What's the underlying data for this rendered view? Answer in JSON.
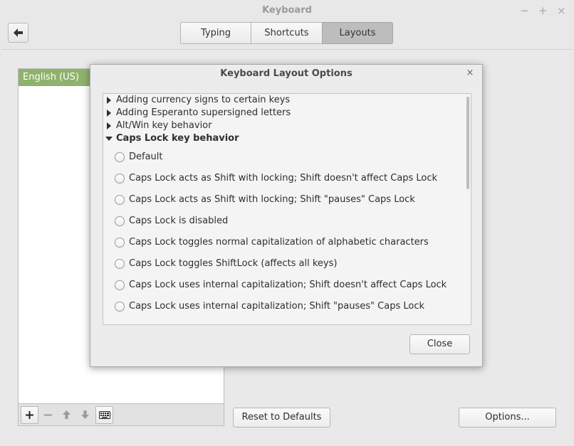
{
  "window": {
    "title": "Keyboard",
    "controls": [
      "−",
      "+",
      "×"
    ]
  },
  "tabs": [
    {
      "label": "Typing"
    },
    {
      "label": "Shortcuts"
    },
    {
      "label": "Layouts"
    }
  ],
  "layouts": {
    "items": [
      {
        "label": "English (US)"
      }
    ],
    "reset_label": "Reset to Defaults",
    "options_label": "Options..."
  },
  "dialog": {
    "title": "Keyboard Layout Options",
    "close_x": "×",
    "close_label": "Close",
    "groups": [
      {
        "label": "Adding currency signs to certain keys",
        "expanded": false
      },
      {
        "label": "Adding Esperanto supersigned letters",
        "expanded": false
      },
      {
        "label": "Alt/Win key behavior",
        "expanded": false
      },
      {
        "label": "Caps Lock key behavior",
        "expanded": true
      }
    ],
    "options": [
      {
        "label": "Default"
      },
      {
        "label": "Caps Lock acts as Shift with locking; Shift doesn't affect Caps Lock"
      },
      {
        "label": "Caps Lock acts as Shift with locking; Shift \"pauses\" Caps Lock"
      },
      {
        "label": "Caps Lock is disabled"
      },
      {
        "label": "Caps Lock toggles normal capitalization of alphabetic characters"
      },
      {
        "label": "Caps Lock toggles ShiftLock (affects all keys)"
      },
      {
        "label": "Caps Lock uses internal capitalization; Shift doesn't affect Caps Lock"
      },
      {
        "label": "Caps Lock uses internal capitalization; Shift \"pauses\" Caps Lock"
      }
    ]
  }
}
